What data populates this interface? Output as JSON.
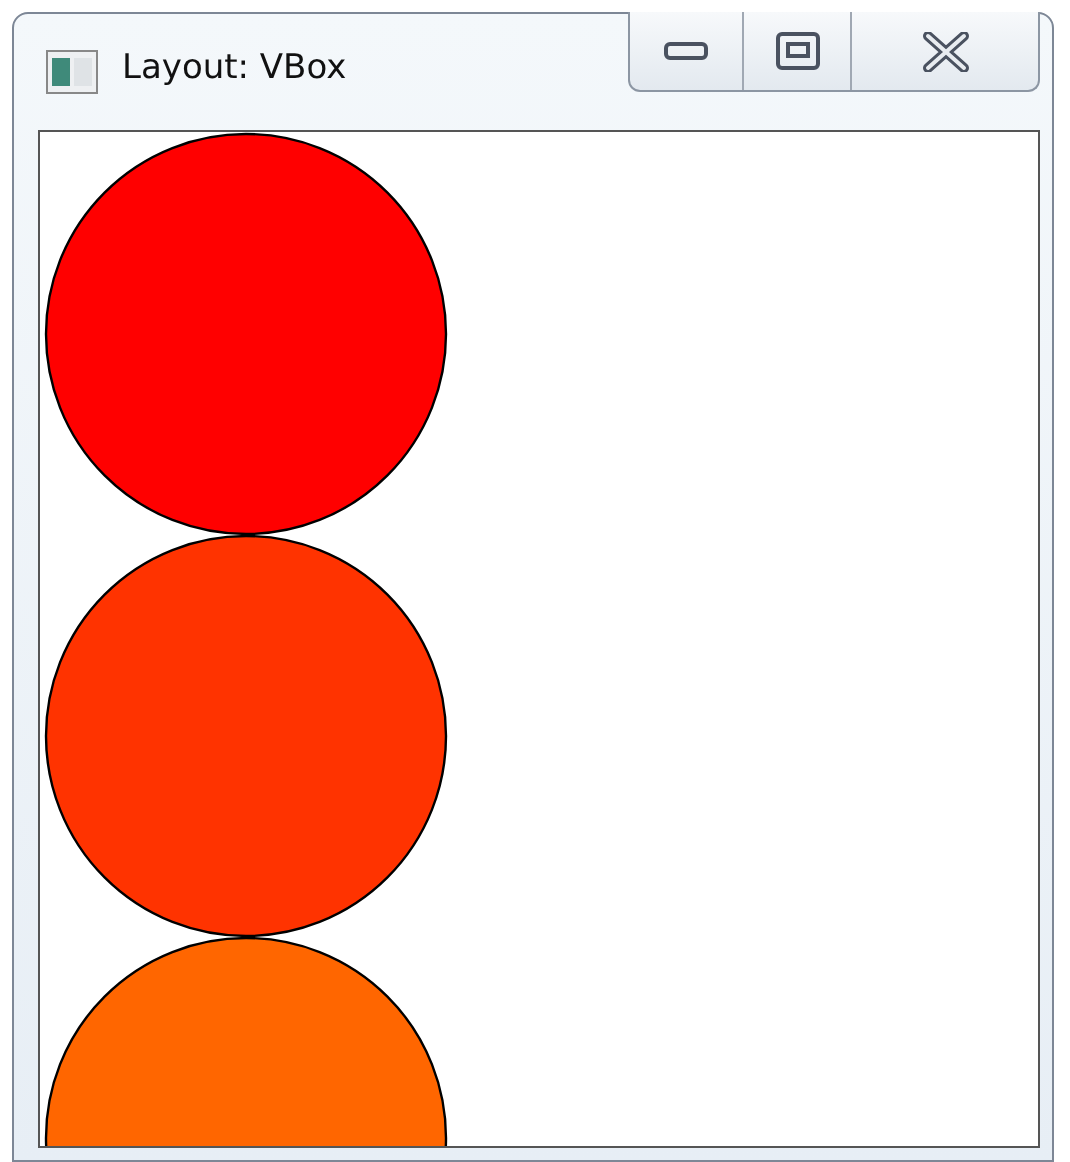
{
  "window": {
    "title": "Layout: VBox"
  },
  "circles": [
    {
      "color": "#ff0000"
    },
    {
      "color": "#ff3300"
    },
    {
      "color": "#ff6600"
    }
  ]
}
